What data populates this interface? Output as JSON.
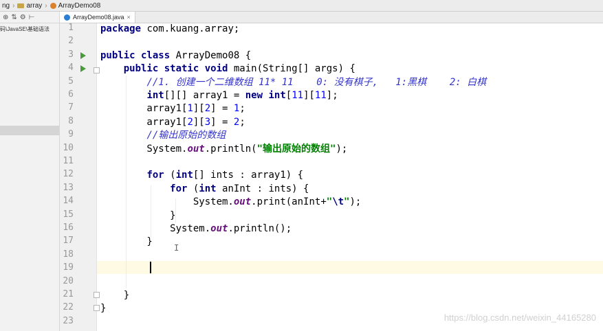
{
  "breadcrumbs": [
    "ng",
    "array",
    "ArrayDemo08"
  ],
  "sidebar": {
    "path_label": "码\\JavaSE\\基础语法"
  },
  "tab": {
    "label": "ArrayDemo08.java"
  },
  "watermark": "https://blog.csdn.net/weixin_44165280",
  "lines": [
    [
      {
        "t": "package",
        "c": "kw"
      },
      {
        "t": " com.kuang.array;"
      }
    ],
    [],
    [
      {
        "t": "public class",
        "c": "kw"
      },
      {
        "t": " ArrayDemo08 {"
      }
    ],
    [
      {
        "t": "    "
      },
      {
        "t": "public static void",
        "c": "kw"
      },
      {
        "t": " main(String[] args) {"
      }
    ],
    [
      {
        "t": "        "
      },
      {
        "t": "//1. 创建一个二维数组 11* 11    0: 没有棋子,   1:黑棋    2: 白棋",
        "c": "cm"
      }
    ],
    [
      {
        "t": "        "
      },
      {
        "t": "int",
        "c": "kw"
      },
      {
        "t": "[][] array1 = "
      },
      {
        "t": "new int",
        "c": "kw"
      },
      {
        "t": "["
      },
      {
        "t": "11",
        "c": "num"
      },
      {
        "t": "]["
      },
      {
        "t": "11",
        "c": "num"
      },
      {
        "t": "];"
      }
    ],
    [
      {
        "t": "        array1["
      },
      {
        "t": "1",
        "c": "num"
      },
      {
        "t": "]["
      },
      {
        "t": "2",
        "c": "num"
      },
      {
        "t": "] = "
      },
      {
        "t": "1",
        "c": "num"
      },
      {
        "t": ";"
      }
    ],
    [
      {
        "t": "        array1["
      },
      {
        "t": "2",
        "c": "num"
      },
      {
        "t": "]["
      },
      {
        "t": "3",
        "c": "num"
      },
      {
        "t": "] = "
      },
      {
        "t": "2",
        "c": "num"
      },
      {
        "t": ";"
      }
    ],
    [
      {
        "t": "        "
      },
      {
        "t": "//输出原始的数组",
        "c": "cm"
      }
    ],
    [
      {
        "t": "        System."
      },
      {
        "t": "out",
        "c": "fld"
      },
      {
        "t": ".println("
      },
      {
        "t": "\"输出原始的数组\"",
        "c": "st"
      },
      {
        "t": ");"
      }
    ],
    [],
    [
      {
        "t": "        "
      },
      {
        "t": "for",
        "c": "kw"
      },
      {
        "t": " ("
      },
      {
        "t": "int",
        "c": "kw"
      },
      {
        "t": "[] ints : array1) {"
      }
    ],
    [
      {
        "t": "            "
      },
      {
        "t": "for",
        "c": "kw"
      },
      {
        "t": " ("
      },
      {
        "t": "int",
        "c": "kw"
      },
      {
        "t": " anInt : ints) {"
      }
    ],
    [
      {
        "t": "                System."
      },
      {
        "t": "out",
        "c": "fld"
      },
      {
        "t": ".print(anInt+"
      },
      {
        "t": "\"",
        "c": "st"
      },
      {
        "t": "\\t",
        "c": "esc"
      },
      {
        "t": "\"",
        "c": "st"
      },
      {
        "t": ");"
      }
    ],
    [
      {
        "t": "            }"
      }
    ],
    [
      {
        "t": "            System."
      },
      {
        "t": "out",
        "c": "fld"
      },
      {
        "t": ".println();"
      }
    ],
    [
      {
        "t": "        }"
      }
    ],
    [],
    [],
    [],
    [
      {
        "t": "    }"
      }
    ],
    [
      {
        "t": "}"
      }
    ],
    []
  ],
  "line_numbers": [
    "1",
    "2",
    "3",
    "4",
    "5",
    "6",
    "7",
    "8",
    "9",
    "10",
    "11",
    "12",
    "13",
    "14",
    "15",
    "16",
    "17",
    "18",
    "19",
    "20",
    "21",
    "22",
    "23"
  ]
}
